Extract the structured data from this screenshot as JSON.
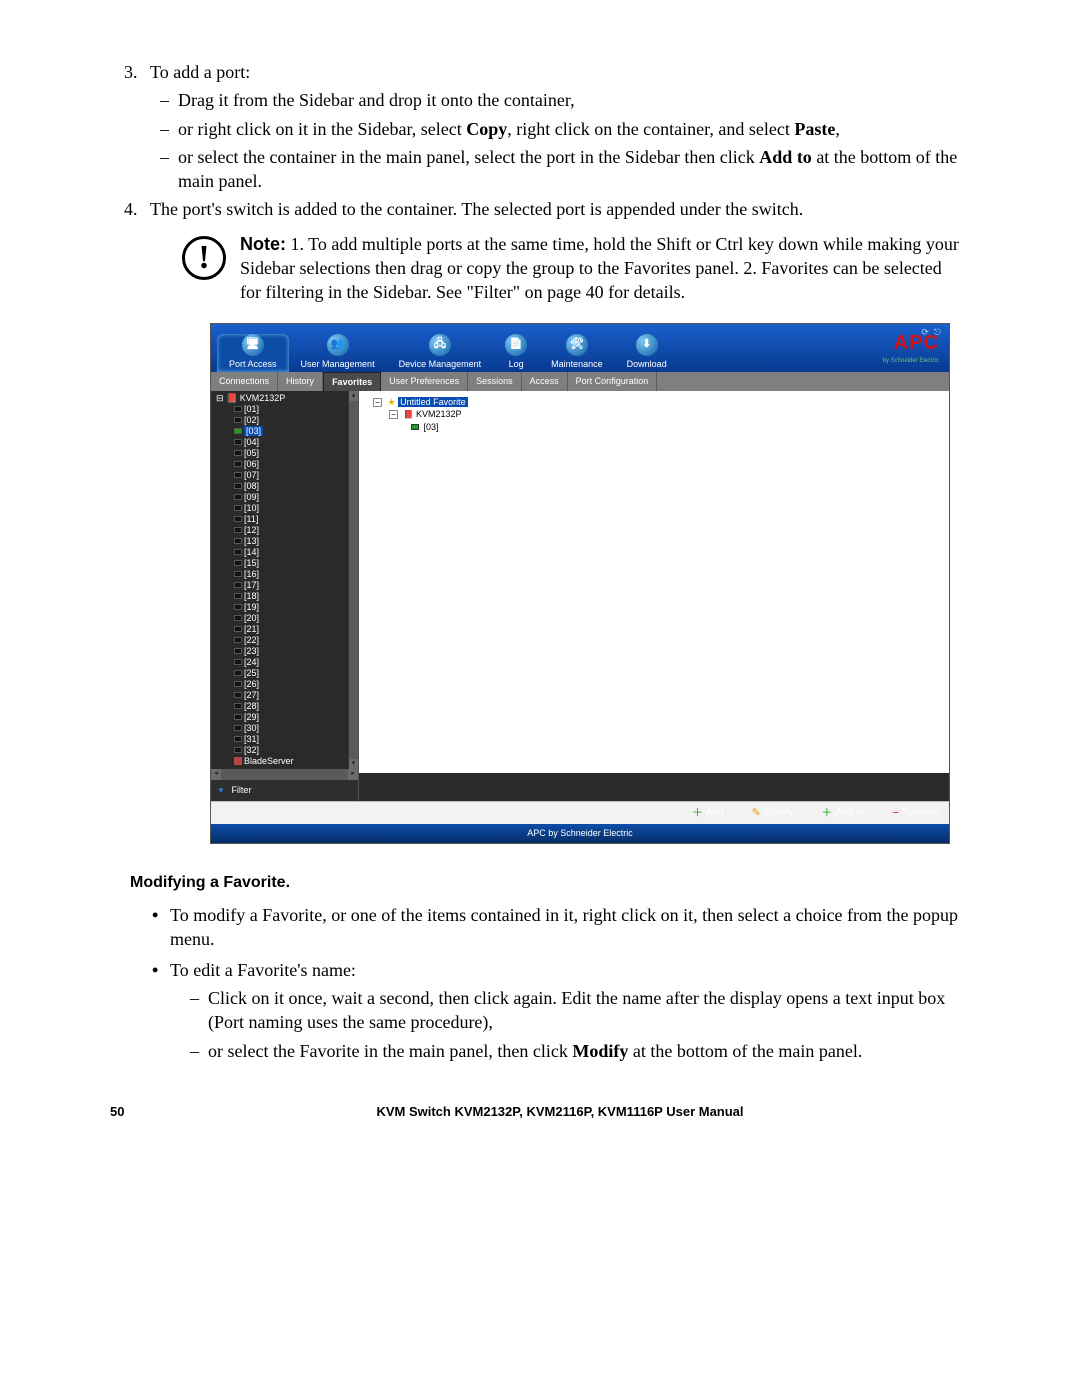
{
  "doc": {
    "list3_label": "To add a port:",
    "list3_dash": [
      "Drag it from the Sidebar and drop it onto the container,",
      "or right click on it in the Sidebar, select <b>Copy</b>, right click on the container, and select <b>Paste</b>,",
      "or select the container in the main panel, select the port in the Sidebar then click <b>Add to</b> at the bottom of the main panel."
    ],
    "list4": "The port's switch is added to the container. The selected port is appended under the switch.",
    "note_label": "Note:",
    "note_text": "1. To add multiple ports at the same time, hold the Shift or Ctrl key down while making your Sidebar selections then drag or copy the group to the Favorites panel. 2. Favorites can be selected for filtering in the Sidebar. See \"Filter\" on page 40 for details.",
    "section_heading": "Modifying a Favorite.",
    "bullets": [
      "To modify a Favorite, or one of the items contained in it, right click on it, then select a choice from the popup menu.",
      "To edit a Favorite's name:"
    ],
    "dash2": [
      "Click on it once, wait a second, then click again. Edit the name after the display opens a text input box (Port naming uses the same procedure),",
      "or select the Favorite in the main panel, then click <b>Modify</b> at the bottom of the main panel."
    ],
    "footer_page": "50",
    "footer_title": "KVM Switch KVM2132P, KVM2116P, KVM1116P User Manual"
  },
  "app": {
    "brand_primary": "APC",
    "brand_secondary": "by Schneider Electric",
    "toolbar": [
      "Port Access",
      "User Management",
      "Device Management",
      "Log",
      "Maintenance",
      "Download"
    ],
    "subtabs_left": [
      "Connections",
      "History",
      "Favorites"
    ],
    "subtabs_right": [
      "User Preferences",
      "Sessions",
      "Access",
      "Port Configuration"
    ],
    "sidebar_root": "KVM2132P",
    "sidebar_ports": [
      "[01]",
      "[02]",
      "[03]",
      "[04]",
      "[05]",
      "[06]",
      "[07]",
      "[08]",
      "[09]",
      "[10]",
      "[11]",
      "[12]",
      "[13]",
      "[14]",
      "[15]",
      "[16]",
      "[17]",
      "[18]",
      "[19]",
      "[20]",
      "[21]",
      "[22]",
      "[23]",
      "[24]",
      "[25]",
      "[26]",
      "[27]",
      "[28]",
      "[29]",
      "[30]",
      "[31]",
      "[32]"
    ],
    "sidebar_selected_index": 2,
    "sidebar_extra": "BladeServer",
    "filter": "Filter",
    "main_tree": {
      "root": "Untitled Favorite",
      "child": "KVM2132P",
      "leaf": "[03]"
    },
    "footer_buttons": [
      {
        "icon": "＋",
        "color": "#1a9f1a",
        "label": "Add"
      },
      {
        "icon": "✎",
        "color": "#e6a400",
        "label": "Modify"
      },
      {
        "icon": "＋",
        "color": "#1a9f1a",
        "label": "Add to"
      },
      {
        "icon": "−",
        "color": "#d11",
        "label": "Remove"
      }
    ],
    "status": "APC by Schneider Electric"
  }
}
